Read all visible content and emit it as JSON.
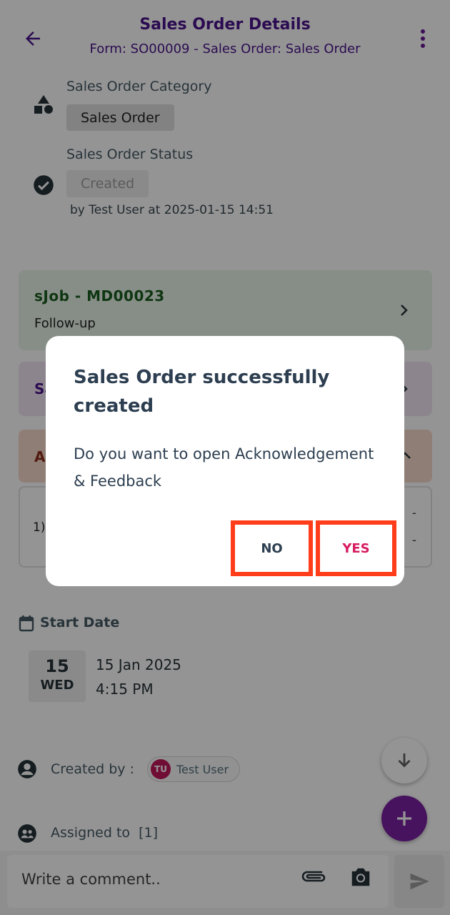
{
  "header": {
    "title": "Sales Order Details",
    "subtitle": "Form: SO00009 - Sales Order: Sales Order"
  },
  "category": {
    "label": "Sales Order Category",
    "value": "Sales Order"
  },
  "status": {
    "label": "Sales Order Status",
    "value": "Created",
    "by_line": "by Test User at 2025-01-15 14:51"
  },
  "cards": {
    "sjob_title": "sJob - MD00023",
    "sjob_subtitle": "Follow-up",
    "sa_text": "Sa",
    "ack_text": "A",
    "list_num": "1)",
    "dash": "-"
  },
  "start_date": {
    "label": "Start Date",
    "day": "15",
    "weekday": "WED",
    "date": "15 Jan 2025",
    "time": "4:15 PM"
  },
  "created_by": {
    "label": "Created by :",
    "initials": "TU",
    "name": "Test User"
  },
  "assigned": {
    "label": "Assigned to",
    "count": "[1]"
  },
  "comment": {
    "placeholder": "Write a comment.."
  },
  "dialog": {
    "title": "Sales Order successfully created",
    "body": "Do you want to open Acknowledgement & Feedback",
    "no_label": "NO",
    "yes_label": "YES"
  },
  "colors": {
    "primary": "#4a148c",
    "highlight_border": "#ff3d1a",
    "yes": "#d81b60",
    "avatar": "#c2185b"
  }
}
